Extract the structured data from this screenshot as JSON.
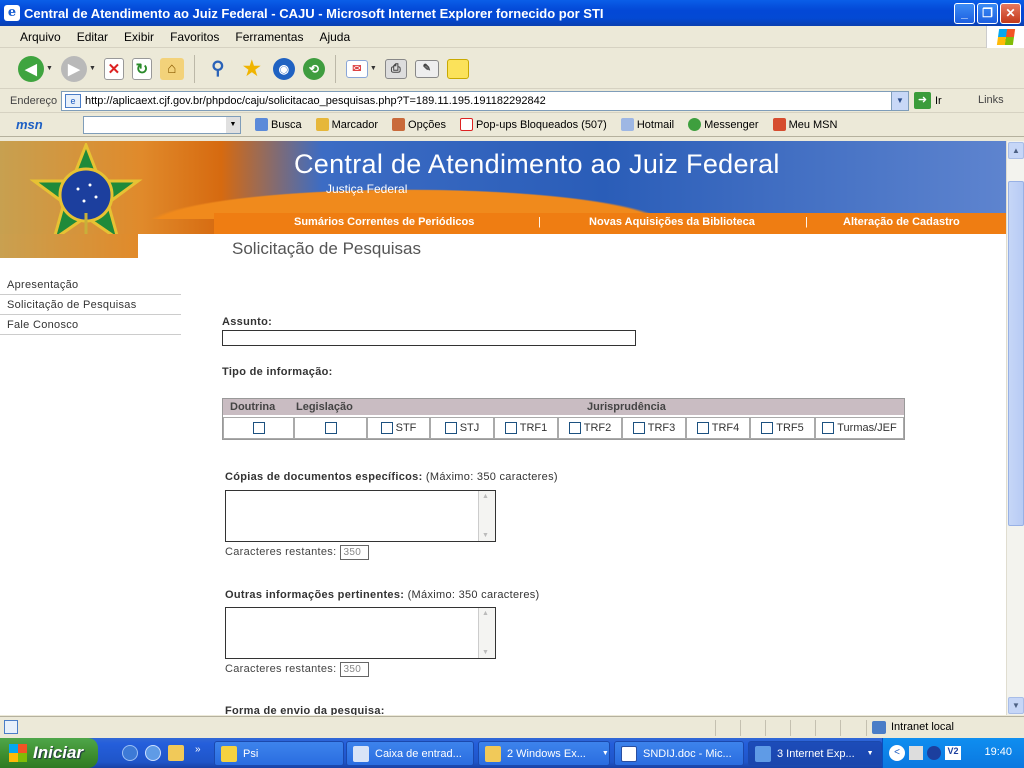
{
  "window": {
    "title": "Central de Atendimento ao Juiz Federal - CAJU - Microsoft Internet Explorer fornecido por STI"
  },
  "menu": [
    "Arquivo",
    "Editar",
    "Exibir",
    "Favoritos",
    "Ferramentas",
    "Ajuda"
  ],
  "address": {
    "label": "Endereço",
    "url": "http://aplicaext.cjf.gov.br/phpdoc/caju/solicitacao_pesquisas.php?T=189.11.195.191182292842",
    "go": "Ir",
    "links": "Links"
  },
  "msnbar": {
    "logo": "msn",
    "items": [
      "Busca",
      "Marcador",
      "Opções",
      "Pop-ups Bloqueados (507)",
      "Hotmail",
      "Messenger",
      "Meu MSN"
    ]
  },
  "site": {
    "title": "Central de Atendimento ao Juiz Federal",
    "subtitle": "Justiça Federal",
    "topnav": [
      "Sumários Correntes de Periódicos",
      "Novas Aquisições da Biblioteca",
      "Alteração de Cadastro"
    ],
    "page_title": "Solicitação de Pesquisas"
  },
  "sidenav": [
    "Apresentação",
    "Solicitação de Pesquisas",
    "Fale Conosco"
  ],
  "form": {
    "assunto_label": "Assunto:",
    "assunto_value": "",
    "tipo_label": "Tipo de informação:",
    "table_headers": {
      "doutrina": "Doutrina",
      "legislacao": "Legislação",
      "jurisprudencia": "Jurisprudência"
    },
    "jurisprudencia_options": [
      "STF",
      "STJ",
      "TRF1",
      "TRF2",
      "TRF3",
      "TRF4",
      "TRF5",
      "Turmas/JEF"
    ],
    "copias_label": "Cópias de documentos específicos:",
    "copias_hint": "(Máximo: 350 caracteres)",
    "outras_label": "Outras informações pertinentes:",
    "outras_hint": "(Máximo: 350 caracteres)",
    "restantes_label": "Caracteres restantes:",
    "restantes_copias": "350",
    "restantes_outras": "350",
    "forma_label": "Forma de envio da pesquisa:"
  },
  "status": {
    "zone": "Intranet local"
  },
  "taskbar": {
    "start": "Iniciar",
    "tasks": [
      "Psi",
      "Caixa de entrad...",
      "2 Windows Ex...",
      "SNDIJ.doc - Mic...",
      "3 Internet Exp..."
    ],
    "clock": "19:40"
  }
}
